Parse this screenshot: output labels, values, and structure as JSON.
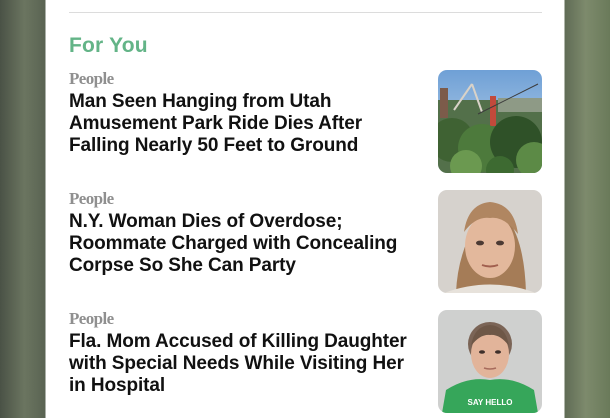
{
  "section": {
    "title": "For You"
  },
  "stories": [
    {
      "source": "People",
      "headline": "Man Seen Hanging from Utah Amusement Park Ride Dies After Falling Nearly 50 Feet to Ground",
      "thumbnail": "amusement-park-photo"
    },
    {
      "source": "People",
      "headline": "N.Y. Woman Dies of Overdose; Roommate Charged with Concealing Corpse So She Can Party",
      "thumbnail": "mugshot-woman-photo"
    },
    {
      "source": "People",
      "headline": "Fla. Mom Accused of Killing Daughter with Special Needs While Visiting Her in Hospital",
      "thumbnail": "mugshot-mom-photo",
      "thumbnail_shirt_text": "SAY HELLO"
    }
  ],
  "colors": {
    "section_title": "#63b487",
    "source": "#8f8f8f",
    "headline": "#111111"
  }
}
